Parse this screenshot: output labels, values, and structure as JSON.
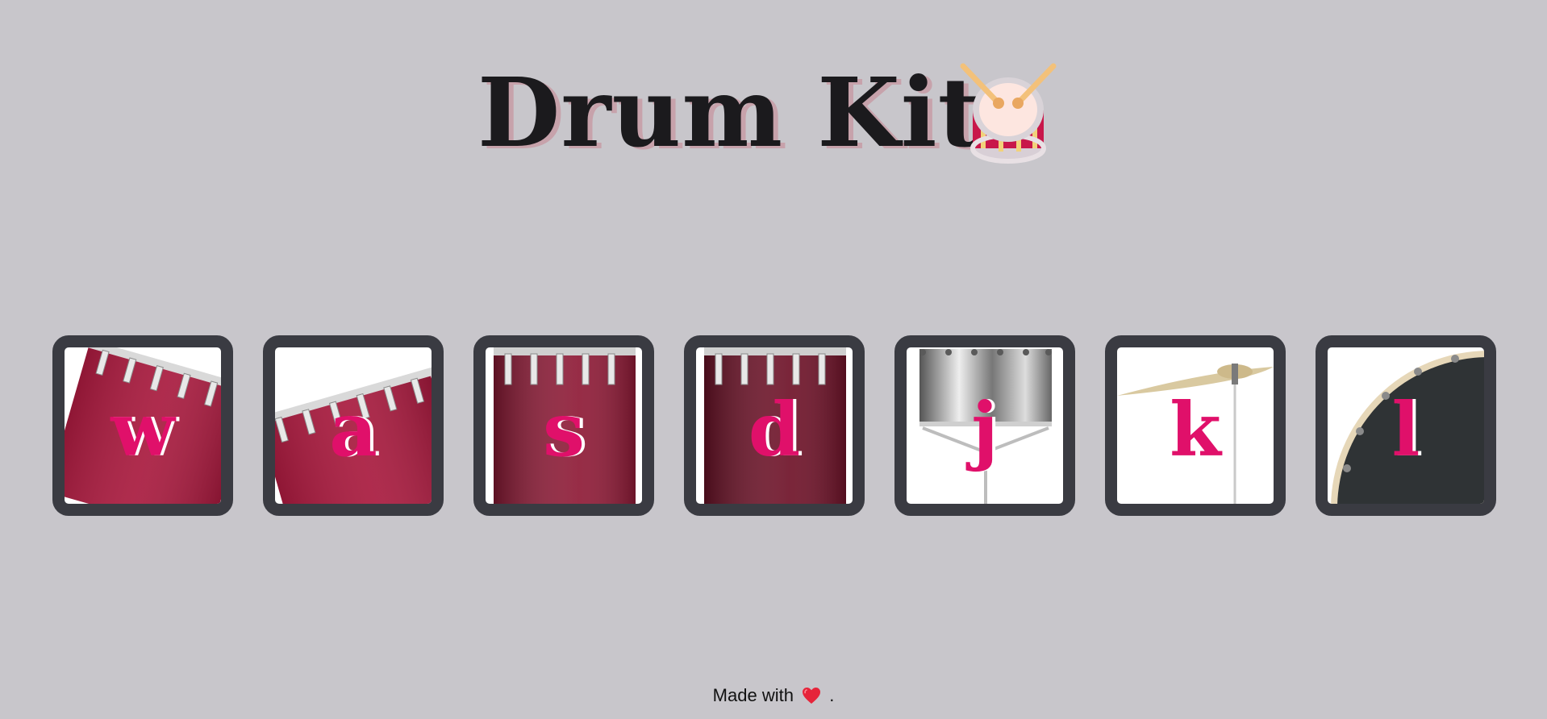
{
  "header": {
    "title": "Drum Kit",
    "title_icon": "drum-icon"
  },
  "drums": [
    {
      "key": "w",
      "instrument": "tom-1"
    },
    {
      "key": "a",
      "instrument": "tom-2"
    },
    {
      "key": "s",
      "instrument": "tom-3"
    },
    {
      "key": "d",
      "instrument": "tom-4"
    },
    {
      "key": "j",
      "instrument": "snare"
    },
    {
      "key": "k",
      "instrument": "crash"
    },
    {
      "key": "l",
      "instrument": "kick-bass"
    }
  ],
  "footer": {
    "prefix": "Made with",
    "icon": "heart-icon",
    "suffix": "."
  },
  "colors": {
    "background": "#c8c6cb",
    "title": "#1b1a1d",
    "key_letter": "#e0106a",
    "drum_border": "#3a3b42",
    "drum_red": "#a81a3e"
  }
}
